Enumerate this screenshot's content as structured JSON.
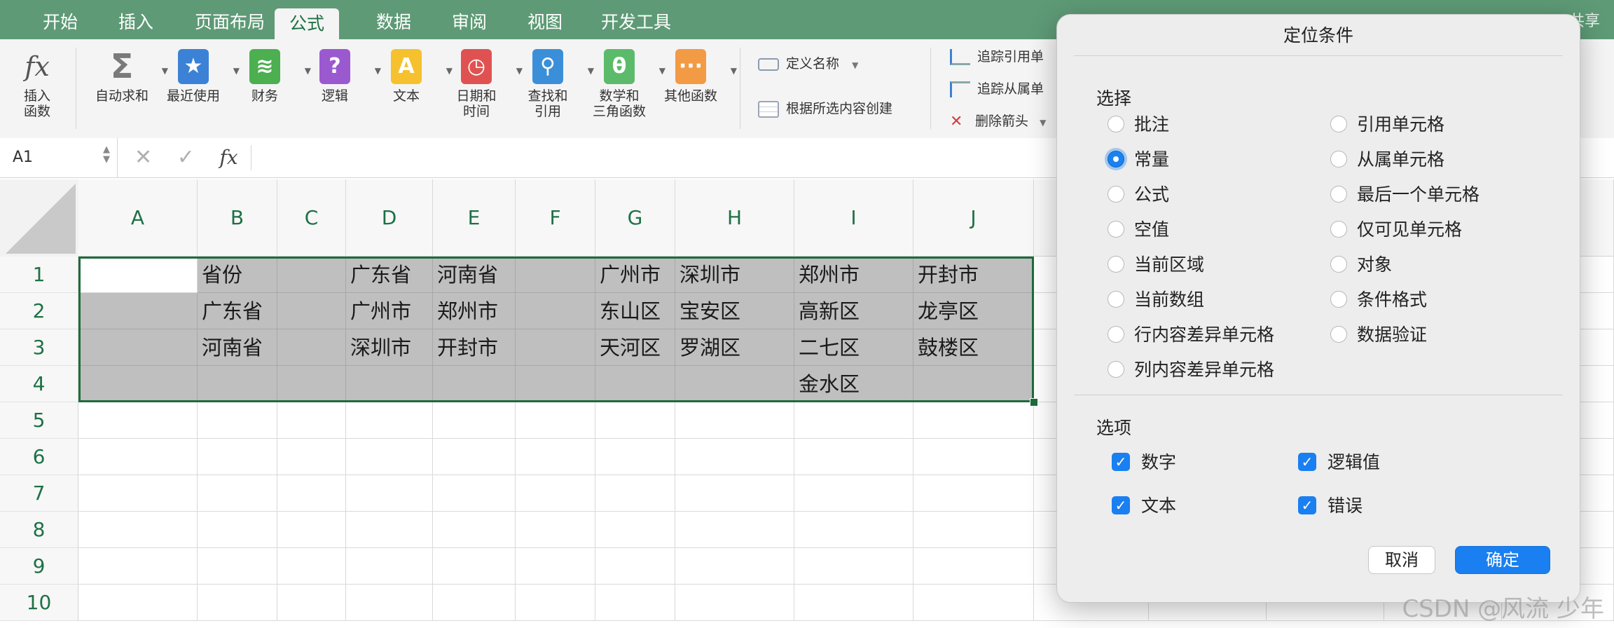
{
  "ribbon_tabs": [
    "开始",
    "插入",
    "页面布局",
    "公式",
    "数据",
    "审阅",
    "视图",
    "开发工具"
  ],
  "active_tab": "公式",
  "share_label": "共享",
  "ribbon": {
    "insert_function": "插入\n函数",
    "groups": [
      {
        "label": "自动求和",
        "icon": "sum-icon",
        "color": "#7a7a7a"
      },
      {
        "label": "最近使用",
        "icon": "star-icon",
        "color": "#3b82d6"
      },
      {
        "label": "财务",
        "icon": "coins-icon",
        "color": "#4caf50"
      },
      {
        "label": "逻辑",
        "icon": "question-icon",
        "color": "#9b59d0"
      },
      {
        "label": "文本",
        "icon": "text-a-icon",
        "color": "#f5c12e"
      },
      {
        "label": "日期和\n时间",
        "icon": "clock-icon",
        "color": "#e05252"
      },
      {
        "label": "查找和\n引用",
        "icon": "magnifier-icon",
        "color": "#3b8fd9"
      },
      {
        "label": "数学和\n三角函数",
        "icon": "theta-icon",
        "color": "#5cbb6a"
      },
      {
        "label": "其他函数",
        "icon": "more-icon",
        "color": "#f39a45"
      }
    ],
    "define_name": "定义名称",
    "create_from_selection": "根据所选内容创建",
    "trace_precedents": "追踪引用单",
    "trace_dependents": "追踪从属单",
    "remove_arrows": "删除箭头"
  },
  "formula_bar": {
    "name_box": "A1",
    "fx": "fx",
    "content": ""
  },
  "columns": [
    "A",
    "B",
    "C",
    "D",
    "E",
    "F",
    "G",
    "H",
    "I",
    "J"
  ],
  "rows": [
    "1",
    "2",
    "3",
    "4",
    "5",
    "6",
    "7",
    "8",
    "9",
    "10"
  ],
  "cells": [
    [
      "",
      "省份",
      "",
      "广东省",
      "河南省",
      "",
      "广州市",
      "深圳市",
      "郑州市",
      "开封市"
    ],
    [
      "",
      "广东省",
      "",
      "广州市",
      "郑州市",
      "",
      "东山区",
      "宝安区",
      "高新区",
      "龙亭区"
    ],
    [
      "",
      "河南省",
      "",
      "深圳市",
      "开封市",
      "",
      "天河区",
      "罗湖区",
      "二七区",
      "鼓楼区"
    ],
    [
      "",
      "",
      "",
      "",
      "",
      "",
      "",
      "",
      "金水区",
      ""
    ]
  ],
  "dialog": {
    "title": "定位条件",
    "select_heading": "选择",
    "radio_left": [
      "批注",
      "常量",
      "公式",
      "空值",
      "当前区域",
      "当前数组",
      "行内容差异单元格",
      "列内容差异单元格"
    ],
    "radio_right": [
      "引用单元格",
      "从属单元格",
      "最后一个单元格",
      "仅可见单元格",
      "对象",
      "条件格式",
      "数据验证"
    ],
    "selected_radio": "常量",
    "options_heading": "选项",
    "checks": [
      {
        "label": "数字",
        "checked": true
      },
      {
        "label": "逻辑值",
        "checked": true
      },
      {
        "label": "文本",
        "checked": true
      },
      {
        "label": "错误",
        "checked": true
      }
    ],
    "cancel": "取消",
    "ok": "确定"
  },
  "watermark": "CSDN @风流 少年"
}
